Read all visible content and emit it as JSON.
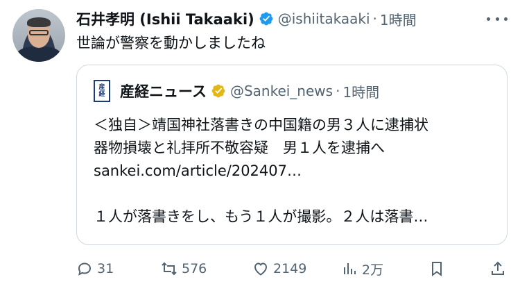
{
  "tweet": {
    "author_name": "石井孝明 (Ishii Takaaki)",
    "handle": "@ishiitakaaki",
    "separator": "·",
    "time": "1時間",
    "text": "世論が警察を動かしましたね"
  },
  "quote": {
    "author_name": "産経ニュース",
    "handle": "@Sankei_news",
    "separator": "·",
    "time": "1時間",
    "lines": [
      "＜独自＞靖国神社落書きの中国籍の男３人に逮捕状",
      "器物損壊と礼拝所不敬容疑　男１人を逮捕へ",
      "sankei.com/article/202407…",
      "",
      "１人が落書きをし、もう１人が撮影。２人は落書…"
    ]
  },
  "actions": {
    "replies": "31",
    "reposts": "576",
    "likes": "2149",
    "views": "2万"
  },
  "colors": {
    "verified_blue": "#1d9bf0",
    "verified_gold": "#e2b719",
    "muted_text": "#536471",
    "border": "#cfd9de"
  },
  "icons": [
    "verified-badge-icon",
    "more-icon",
    "reply-icon",
    "repost-icon",
    "like-icon",
    "views-icon",
    "bookmark-icon",
    "share-icon"
  ]
}
